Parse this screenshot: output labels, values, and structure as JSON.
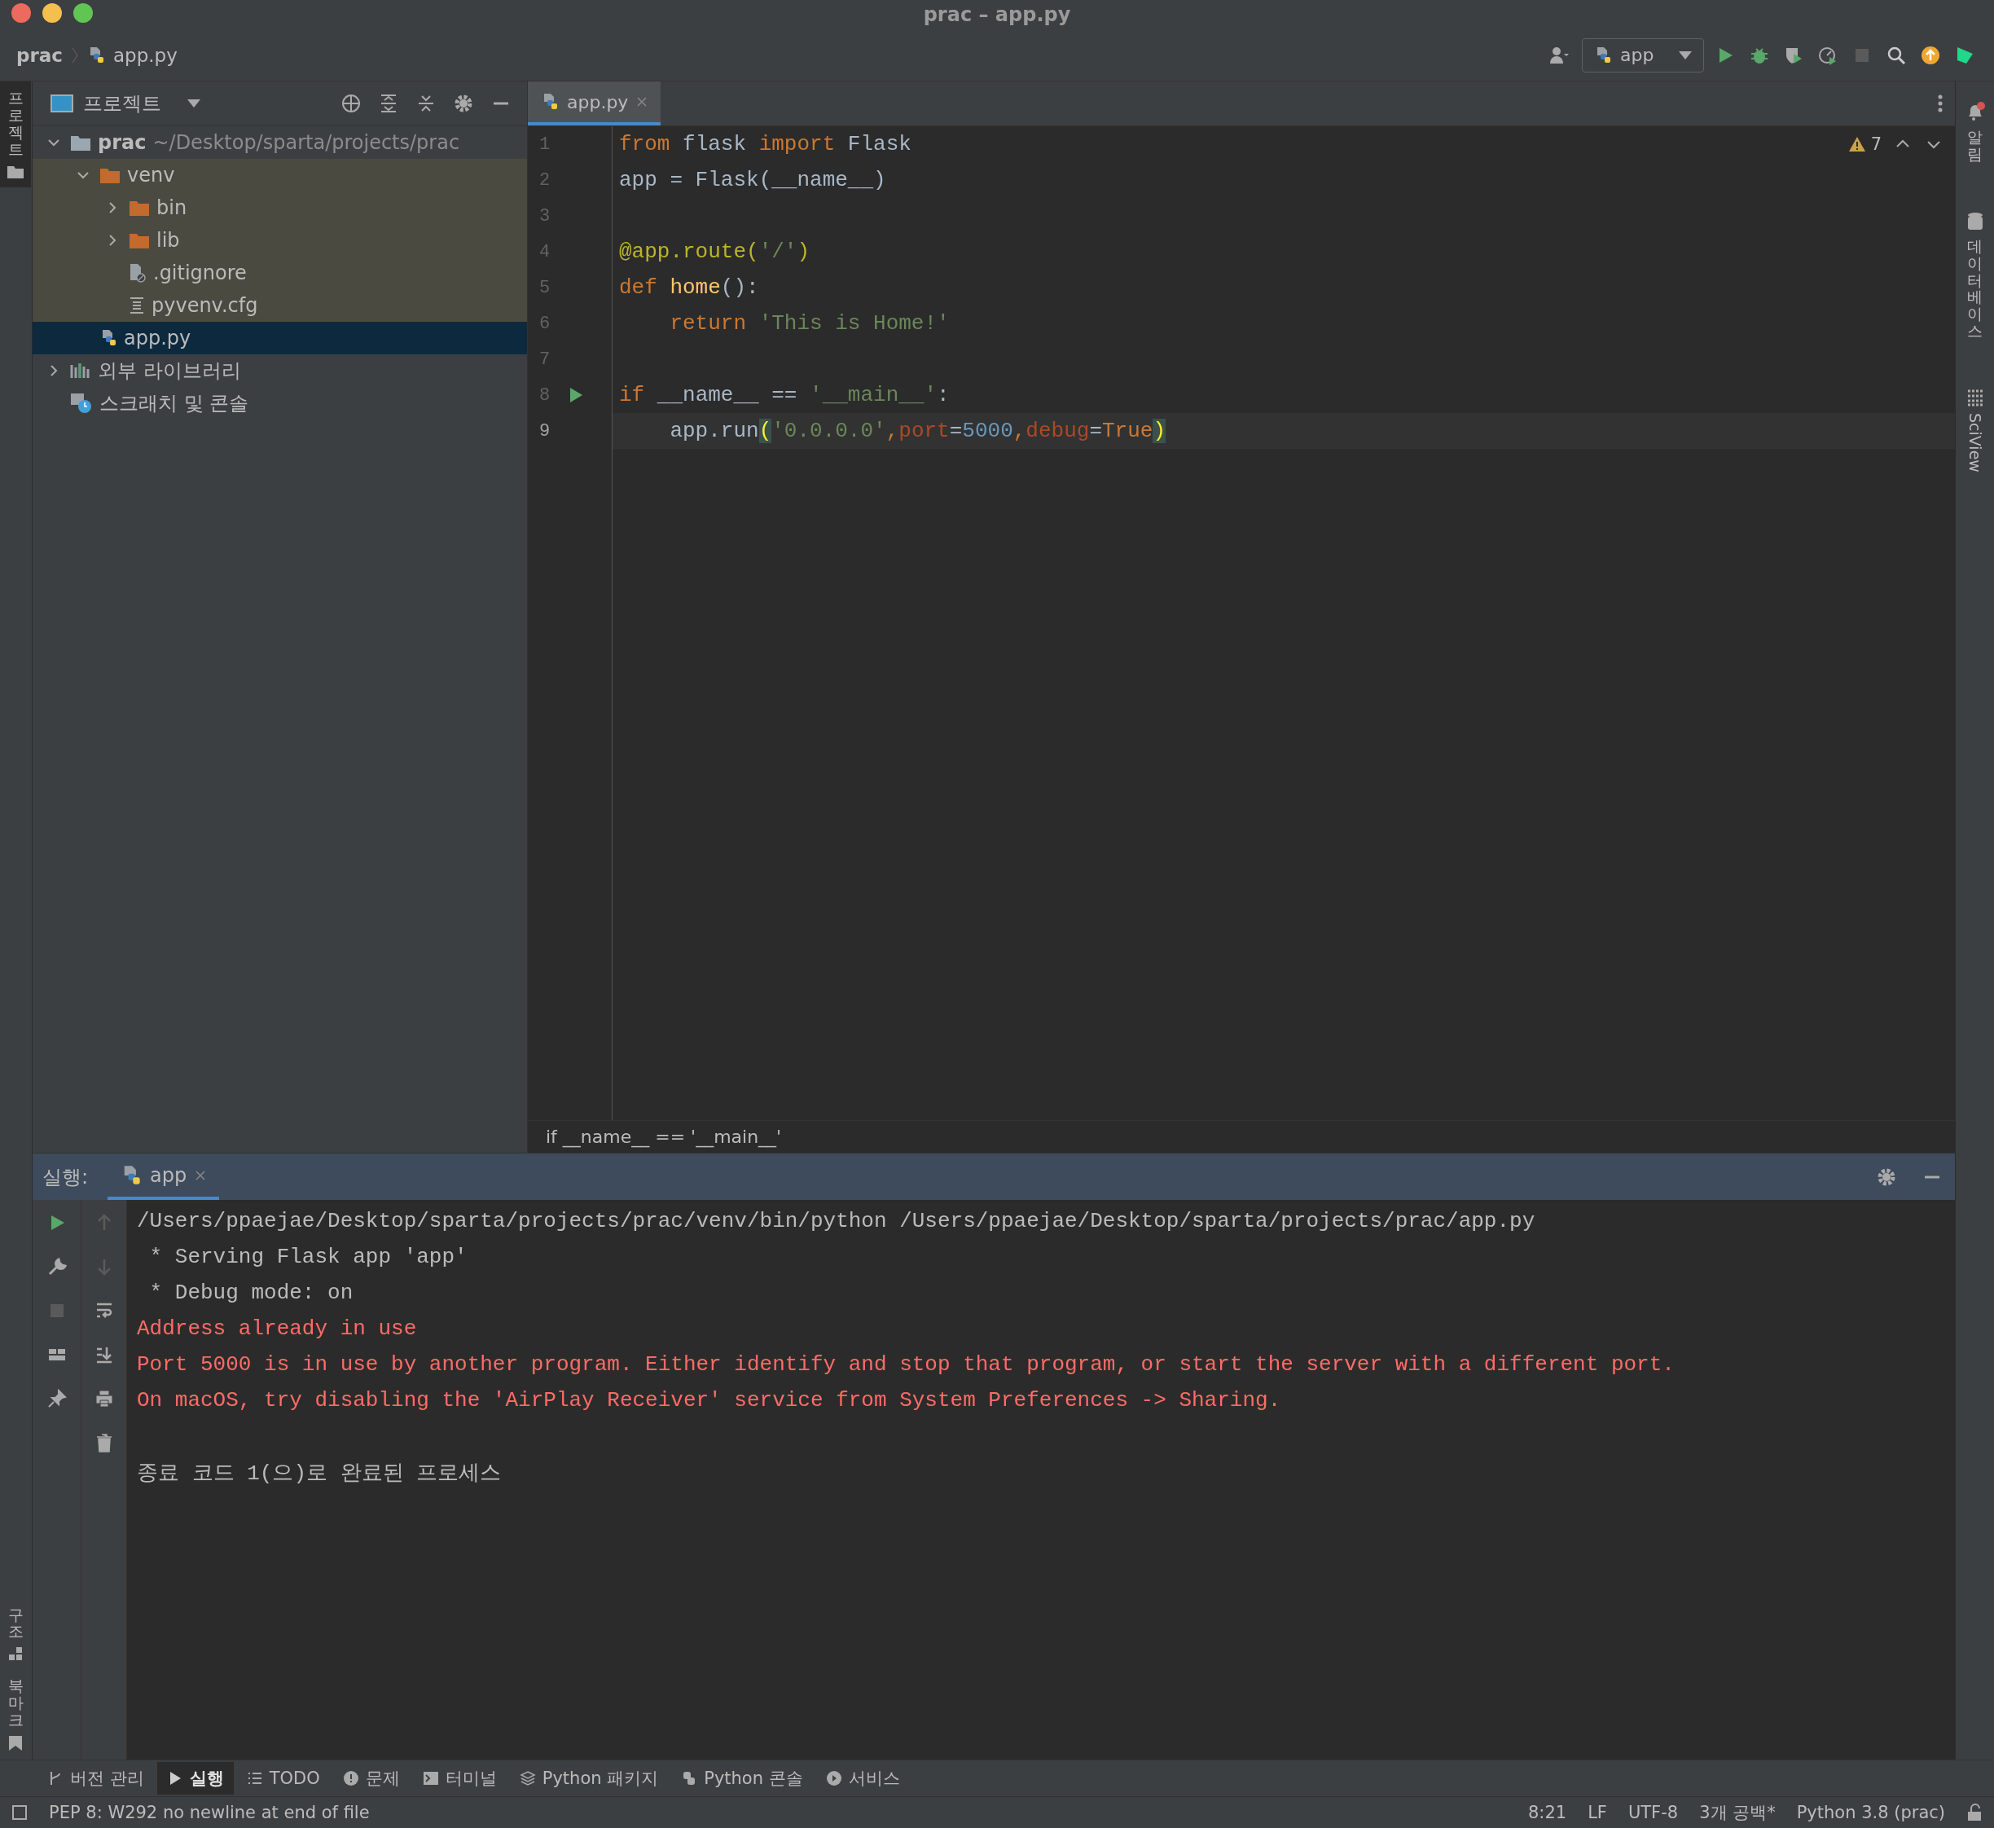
{
  "window": {
    "title": "prac – app.py"
  },
  "nav": {
    "crumbs": [
      {
        "label": "prac",
        "kind": "project"
      },
      {
        "label": "app.py",
        "kind": "python"
      }
    ],
    "run_config": "app"
  },
  "left_strip": {
    "top": [
      {
        "label": "프로젝트",
        "selected": true
      }
    ],
    "bottom": [
      {
        "label": "구조",
        "kind": "structure"
      },
      {
        "label": "북마크",
        "kind": "bookmark"
      }
    ]
  },
  "right_strip": [
    {
      "label": "알림",
      "kind": "bell"
    },
    {
      "label": "데이터베이스",
      "kind": "database"
    },
    {
      "label": "SciView",
      "kind": "grid"
    }
  ],
  "project": {
    "title": "프로젝트",
    "tree": [
      {
        "label": "prac",
        "path": "~/Desktop/sparta/projects/prac",
        "kind": "root",
        "expanded": true,
        "selected": false,
        "excluded": false,
        "children": [
          {
            "label": "venv",
            "kind": "folder",
            "expanded": true,
            "selected": false,
            "excluded": true,
            "children": [
              {
                "label": "bin",
                "kind": "folder",
                "expanded": false,
                "selected": false,
                "excluded": true
              },
              {
                "label": "lib",
                "kind": "folder",
                "expanded": false,
                "selected": false,
                "excluded": true
              },
              {
                "label": ".gitignore",
                "kind": "ignore",
                "selected": false,
                "excluded": true
              },
              {
                "label": "pyvenv.cfg",
                "kind": "config",
                "selected": false,
                "excluded": true
              }
            ]
          },
          {
            "label": "app.py",
            "kind": "python",
            "selected": true,
            "excluded": false
          }
        ]
      },
      {
        "label": "외부 라이브러리",
        "kind": "library",
        "expanded": false,
        "selected": false,
        "excluded": false
      },
      {
        "label": "스크래치 및 콘솔",
        "kind": "scratch",
        "selected": false,
        "excluded": false
      }
    ]
  },
  "editor": {
    "tabs": [
      {
        "label": "app.py",
        "selected": true
      }
    ],
    "warnings": "7",
    "lines": [
      {
        "number": "1",
        "current": false,
        "runnable": false,
        "tokens": [
          {
            "kind": "kw",
            "text": "from"
          },
          {
            "kind": "plain",
            "text": " flask "
          },
          {
            "kind": "kw",
            "text": "import"
          },
          {
            "kind": "plain",
            "text": " Flask"
          }
        ]
      },
      {
        "number": "2",
        "current": false,
        "runnable": false,
        "tokens": [
          {
            "kind": "plain",
            "text": "app = Flask(__name__)"
          }
        ]
      },
      {
        "number": "3",
        "current": false,
        "runnable": false
      },
      {
        "number": "4",
        "current": false,
        "runnable": false,
        "tokens": [
          {
            "kind": "deco",
            "text": "@app.route("
          },
          {
            "kind": "str",
            "text": "'/'"
          },
          {
            "kind": "deco",
            "text": ")"
          }
        ]
      },
      {
        "number": "5",
        "current": false,
        "runnable": false,
        "tokens": [
          {
            "kind": "kw",
            "text": "def"
          },
          {
            "kind": "fn",
            "text": " home"
          },
          {
            "kind": "plain",
            "text": "():"
          }
        ]
      },
      {
        "number": "6",
        "current": false,
        "runnable": false,
        "tokens": [
          {
            "kind": "kw",
            "text": "    return"
          },
          {
            "kind": "str",
            "text": " 'This is Home!'"
          }
        ]
      },
      {
        "number": "7",
        "current": false,
        "runnable": false
      },
      {
        "number": "8",
        "current": false,
        "runnable": true,
        "tokens": [
          {
            "kind": "kw",
            "text": "if"
          },
          {
            "kind": "plain",
            "text": " __name__ == "
          },
          {
            "kind": "str",
            "text": "'__main__'"
          },
          {
            "kind": "plain",
            "text": ":"
          }
        ]
      },
      {
        "number": "9",
        "current": true,
        "runnable": false,
        "tokens": [
          {
            "kind": "plain",
            "text": "    app.run"
          },
          {
            "kind": "match",
            "text": "("
          },
          {
            "kind": "str",
            "text": "'0.0.0.0'"
          },
          {
            "kind": "kw",
            "text": ","
          },
          {
            "kind": "param",
            "text": "port"
          },
          {
            "kind": "plain",
            "text": "="
          },
          {
            "kind": "num",
            "text": "5000"
          },
          {
            "kind": "kw",
            "text": ","
          },
          {
            "kind": "param",
            "text": "debug"
          },
          {
            "kind": "plain",
            "text": "="
          },
          {
            "kind": "kw",
            "text": "True"
          },
          {
            "kind": "match",
            "text": ")"
          }
        ]
      }
    ],
    "breadcrumb": "if __name__ == '__main__'"
  },
  "run": {
    "label": "실행:",
    "tabs": [
      {
        "label": "app",
        "selected": true
      }
    ],
    "console": [
      {
        "kind": "info",
        "text": "/Users/ppaejae/Desktop/sparta/projects/prac/venv/bin/python /Users/ppaejae/Desktop/sparta/projects/prac/app.py"
      },
      {
        "kind": "info",
        "text": " * Serving Flask app 'app'"
      },
      {
        "kind": "info",
        "text": " * Debug mode: on"
      },
      {
        "kind": "error",
        "text": "Address already in use"
      },
      {
        "kind": "error",
        "text": "Port 5000 is in use by another program. Either identify and stop that program, or start the server with a different port."
      },
      {
        "kind": "error",
        "text": "On macOS, try disabling the 'AirPlay Receiver' service from System Preferences -> Sharing."
      },
      {
        "kind": "exit",
        "text": "종료 코드 1(으)로 완료된 프로세스"
      }
    ]
  },
  "tool_windows": [
    {
      "label": "버전 관리",
      "kind": "vcs",
      "selected": false
    },
    {
      "label": "실행",
      "kind": "run",
      "selected": true
    },
    {
      "label": "TODO",
      "kind": "list",
      "selected": false
    },
    {
      "label": "문제",
      "kind": "problem",
      "selected": false
    },
    {
      "label": "터미널",
      "kind": "terminal",
      "selected": false
    },
    {
      "label": "Python 패키지",
      "kind": "layers",
      "selected": false
    },
    {
      "label": "Python 콘솔",
      "kind": "python",
      "selected": false
    },
    {
      "label": "서비스",
      "kind": "services",
      "selected": false
    }
  ],
  "status_bar": {
    "message": "PEP 8: W292 no newline at end of file",
    "items": [
      "8:21",
      "LF",
      "UTF-8",
      "3개 공백*",
      "Python 3.8 (prac)"
    ]
  }
}
